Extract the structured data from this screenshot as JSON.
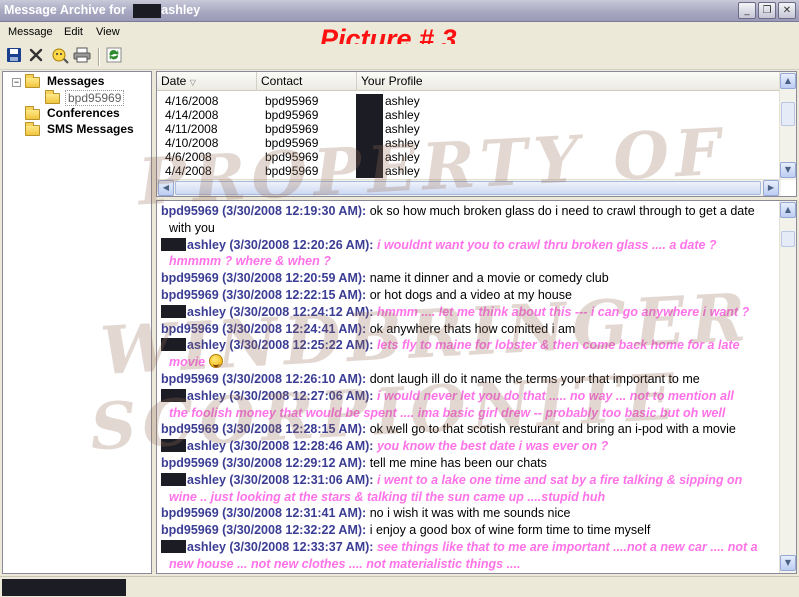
{
  "window": {
    "title_prefix": "Message Archive for",
    "title_user": "ashley"
  },
  "menu": [
    "Message",
    "Edit",
    "View"
  ],
  "annotation": "Picture # 3",
  "watermark": [
    "PROPERTY OF",
    "WINDBRINGER",
    "SCORPIONITE"
  ],
  "toolbar": {
    "icons": [
      "save-icon",
      "delete-icon",
      "search-person-icon",
      "print-icon",
      "refresh-icon"
    ],
    "colors": {
      "save": "#1a3f8f",
      "delete": "#333333",
      "refresh": "#2f8a2f"
    }
  },
  "tree": {
    "messages": "Messages",
    "contact": "bpd95969",
    "conferences": "Conferences",
    "sms": "SMS Messages"
  },
  "list": {
    "columns": [
      "Date",
      "Contact",
      "Your Profile"
    ],
    "rows": [
      {
        "date": "4/16/2008",
        "contact": "bpd95969",
        "profile": "ashley"
      },
      {
        "date": "4/14/2008",
        "contact": "bpd95969",
        "profile": "ashley"
      },
      {
        "date": "4/11/2008",
        "contact": "bpd95969",
        "profile": "ashley"
      },
      {
        "date": "4/10/2008",
        "contact": "bpd95969",
        "profile": "ashley"
      },
      {
        "date": "4/6/2008",
        "contact": "bpd95969",
        "profile": "ashley"
      },
      {
        "date": "4/4/2008",
        "contact": "bpd95969",
        "profile": "ashley"
      }
    ]
  },
  "conversation": {
    "colors": {
      "contact_meta": "#3b3d94",
      "you_text": "#ff72e8"
    },
    "messages": [
      {
        "meta": "bpd95969 (3/30/2008 12:19:30 AM):",
        "text": "ok so how much broken glass do i need to crawl through to get a date",
        "cont": "with you"
      },
      {
        "meta": "ashley (3/30/2008 12:20:26 AM):",
        "text": "i wouldnt want you to crawl thru broken glass .... a date ?",
        "cont": "hmmmm ? where & when ?"
      },
      {
        "meta": "bpd95969 (3/30/2008 12:20:59 AM):",
        "text": "name it dinner and a movie or comedy club"
      },
      {
        "meta": "bpd95969 (3/30/2008 12:22:15 AM):",
        "text": "or hot dogs and a video at my house"
      },
      {
        "meta": "ashley (3/30/2008 12:24:12 AM):",
        "text": "hmmm .... let me think about this --- i can go anywhere i want ?"
      },
      {
        "meta": "bpd95969 (3/30/2008 12:24:41 AM):",
        "text": "ok anywhere thats how comitted i am"
      },
      {
        "meta": "ashley (3/30/2008 12:25:22 AM):",
        "text": "lets fly to maine for lobster & then come back home for a late",
        "cont": "movie"
      },
      {
        "meta": "bpd95969 (3/30/2008 12:26:10 AM):",
        "text": "dont laugh ill do it name the terms your that important to me"
      },
      {
        "meta": "ashley (3/30/2008 12:27:06 AM):",
        "text": "i would never let you do that ..... no way ... not to mention all",
        "cont": "the foolish money that would be spent .... ima basic girl drew -- probably too basic but oh well"
      },
      {
        "meta": "bpd95969 (3/30/2008 12:28:15 AM):",
        "text": "ok well go to that scotish resturant and bring an i-pod with a movie"
      },
      {
        "meta": "ashley (3/30/2008 12:28:46 AM):",
        "text": "you know the best date i was ever on ?"
      },
      {
        "meta": "bpd95969 (3/30/2008 12:29:12 AM):",
        "text": "tell me mine has been our chats"
      },
      {
        "meta": "ashley (3/30/2008 12:31:06 AM):",
        "text": "i went to a lake one time and sat by a fire talking & sipping on",
        "cont": "wine .. just looking at the stars & talking til the sun came up ....stupid huh"
      },
      {
        "meta": "bpd95969 (3/30/2008 12:31:41 AM):",
        "text": "no i wish it was with me sounds nice"
      },
      {
        "meta": "bpd95969 (3/30/2008 12:32:22 AM):",
        "text": "i enjoy a good box of wine form time to time myself"
      },
      {
        "meta": "ashley (3/30/2008 12:33:37 AM):",
        "text": "see things like that to me are important ....not a new car .... not a",
        "cont": "new house ... not new clothes .... not materialistic things ...."
      }
    ]
  }
}
